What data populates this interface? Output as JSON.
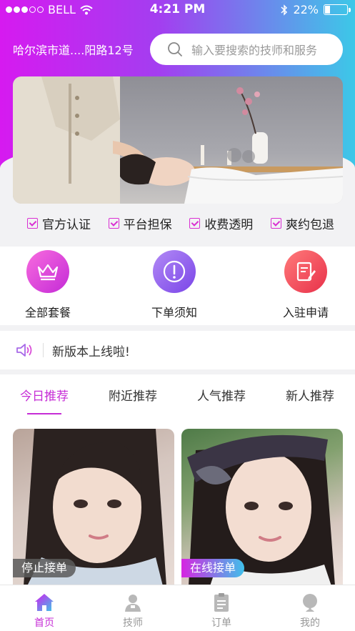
{
  "status_bar": {
    "carrier": "BELL",
    "time": "4:21 PM",
    "battery": "22%",
    "battery_level": 0.22
  },
  "header": {
    "location": "哈尔滨市道....阳路12号",
    "search_placeholder": "输入要搜索的技师和服务"
  },
  "guarantees": [
    "官方认证",
    "平台担保",
    "收费透明",
    "爽约包退"
  ],
  "actions": [
    {
      "label": "全部套餐",
      "icon": "crown-icon"
    },
    {
      "label": "下单须知",
      "icon": "exclamation-icon"
    },
    {
      "label": "入驻申请",
      "icon": "edit-form-icon"
    }
  ],
  "notice": {
    "text": "新版本上线啦!"
  },
  "tabs": [
    {
      "label": "今日推荐",
      "active": true
    },
    {
      "label": "附近推荐",
      "active": false
    },
    {
      "label": "人气推荐",
      "active": false
    },
    {
      "label": "新人推荐",
      "active": false
    }
  ],
  "cards": [
    {
      "status": "停止接单"
    },
    {
      "status": "在线接单"
    }
  ],
  "bottom_nav": [
    {
      "label": "首页",
      "icon": "home-icon",
      "active": true
    },
    {
      "label": "技师",
      "icon": "technician-icon",
      "active": false
    },
    {
      "label": "订单",
      "icon": "order-icon",
      "active": false
    },
    {
      "label": "我的",
      "icon": "profile-icon",
      "active": false
    }
  ],
  "colors": {
    "accent": "#c62dd6",
    "gradient_start": "#d61af0",
    "gradient_end": "#3cc8e8"
  }
}
